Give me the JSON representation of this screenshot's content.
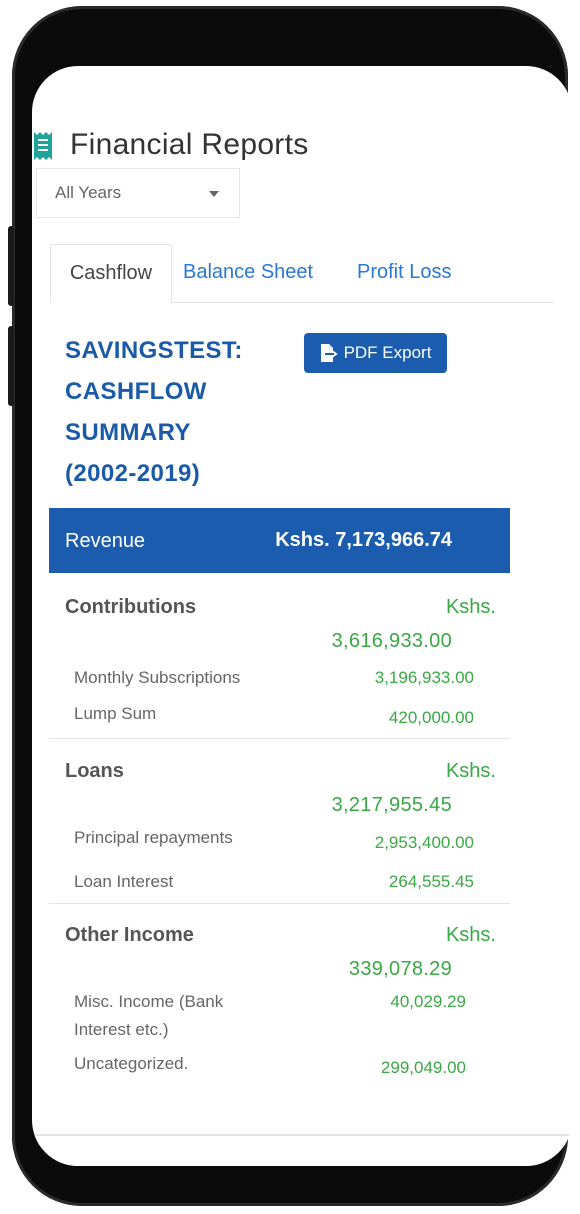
{
  "header": {
    "title": "Financial Reports",
    "icon": "receipt-icon"
  },
  "filter": {
    "selected": "All Years"
  },
  "tabs": [
    {
      "label": "Cashflow",
      "active": true
    },
    {
      "label": "Balance Sheet",
      "active": false
    },
    {
      "label": "Profit Loss",
      "active": false
    }
  ],
  "report": {
    "title_lines": [
      "SAVINGSTEST:",
      "CASHFLOW",
      "SUMMARY",
      "(2002-2019)"
    ],
    "export_label": "PDF Export"
  },
  "revenue": {
    "label": "Revenue",
    "amount": "Kshs. 7,173,966.74"
  },
  "sections": [
    {
      "name": "Contributions",
      "currency": "Kshs.",
      "total": "3,616,933.00",
      "items": [
        {
          "name": "Monthly Subscriptions",
          "value": "3,196,933.00"
        },
        {
          "name": "Lump Sum",
          "value": "420,000.00"
        }
      ]
    },
    {
      "name": "Loans",
      "currency": "Kshs.",
      "total": "3,217,955.45",
      "items": [
        {
          "name": "Principal repayments",
          "value": "2,953,400.00"
        },
        {
          "name": "Loan Interest",
          "value": "264,555.45"
        }
      ]
    },
    {
      "name": "Other Income",
      "currency": "Kshs.",
      "total": "339,078.29",
      "items": [
        {
          "name": "Misc. Income (Bank Interest etc.)",
          "value": "40,029.29"
        },
        {
          "name": "Uncategorized.",
          "value": "299,049.00"
        }
      ]
    }
  ],
  "colors": {
    "primary": "#1c5cae",
    "link": "#2878d8",
    "positive": "#3aa845"
  }
}
